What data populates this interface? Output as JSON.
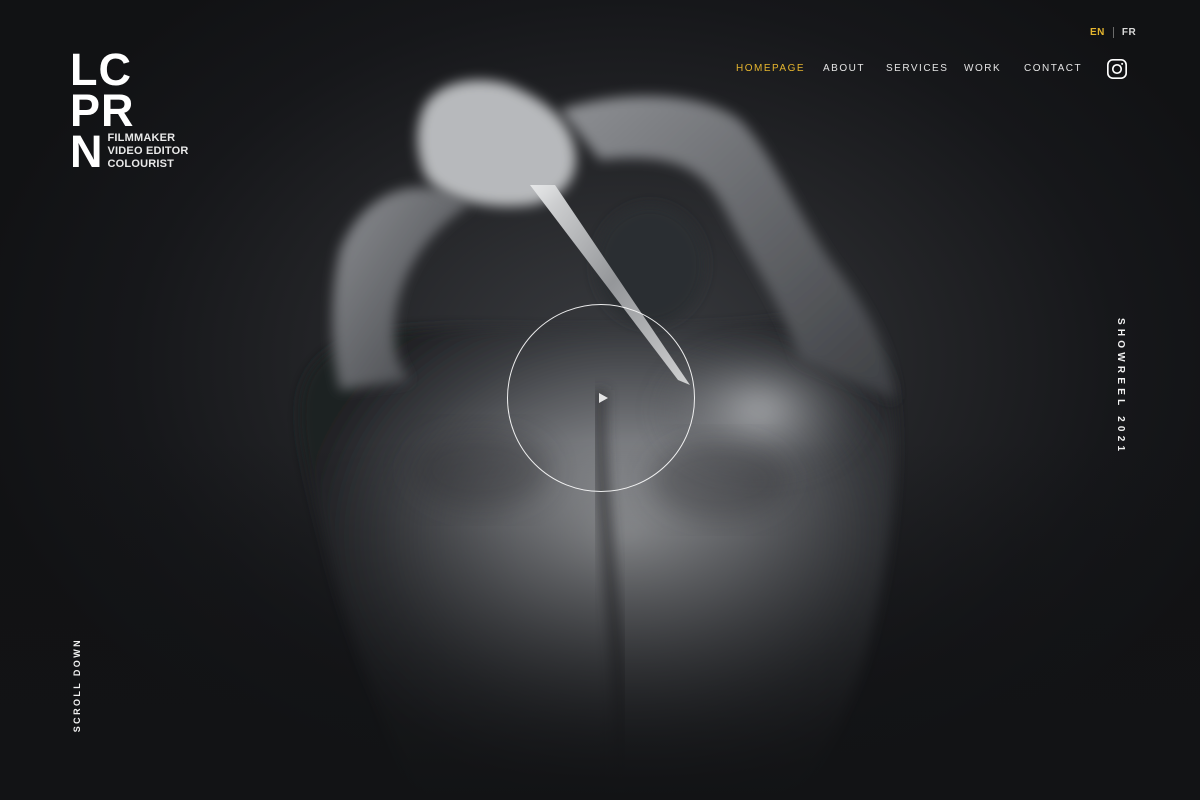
{
  "logo": {
    "line1": "LC",
    "line2": "PR",
    "line3": "N",
    "roles": [
      "FILMMAKER",
      "VIDEO EDITOR",
      "COLOURIST"
    ]
  },
  "language": {
    "current": "EN",
    "other": "FR",
    "accent_color": "#e5b52e"
  },
  "nav": {
    "items": [
      {
        "label": "HOMEPAGE",
        "active": true
      },
      {
        "label": "ABOUT",
        "active": false
      },
      {
        "label": "SERVICES",
        "active": false
      },
      {
        "label": "WORK",
        "active": false
      },
      {
        "label": "CONTACT",
        "active": false
      }
    ],
    "social_icon": "instagram-icon"
  },
  "hero": {
    "side_label": "SHOWREEL 2021",
    "scroll_label": "SCROLL DOWN",
    "play_icon": "play-icon",
    "image_description_icon": "hero-photo"
  }
}
